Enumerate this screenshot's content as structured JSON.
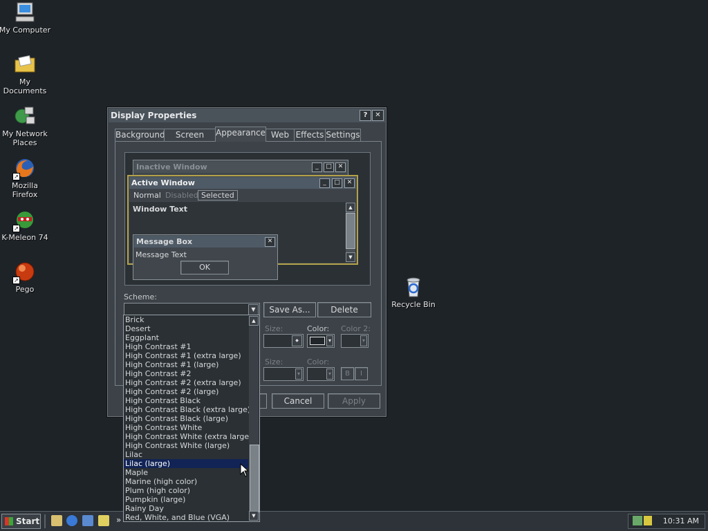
{
  "desktop": {
    "icons": [
      {
        "label": "My Computer",
        "icon": "computer-icon"
      },
      {
        "label": "My Documents",
        "icon": "folder-icon"
      },
      {
        "label": "My Network",
        "label2": "Places",
        "icon": "network-icon"
      },
      {
        "label": "Mozilla Firefox",
        "icon": "firefox-icon"
      },
      {
        "label": "K-Meleon 74",
        "icon": "kmeleon-icon"
      },
      {
        "label": "Pego",
        "icon": "pego-icon"
      },
      {
        "label": "Recycle Bin",
        "icon": "recycle-bin-icon"
      }
    ]
  },
  "dialog": {
    "title": "Display Properties",
    "help_glyph": "?",
    "close_glyph": "✕",
    "tabs": [
      "Background",
      "Screen Saver",
      "Appearance",
      "Web",
      "Effects",
      "Settings"
    ],
    "active_tab": "Appearance",
    "preview": {
      "inactive_title": "Inactive Window",
      "active_title": "Active Window",
      "menu": [
        "Normal",
        "Disabled",
        "Selected"
      ],
      "window_text": "Window Text",
      "msgbox_title": "Message Box",
      "msgbox_text": "Message Text",
      "ok": "OK"
    },
    "scheme_label": "Scheme:",
    "scheme_value": "",
    "save_as": "Save As...",
    "delete": "Delete",
    "size_label": "Size:",
    "color_label": "Color:",
    "color2_label": "Color 2:",
    "size2_label": "Size:",
    "color3_label": "Color:",
    "bold_glyph": "B",
    "italic_glyph": "I",
    "cancel": "Cancel",
    "apply": "Apply"
  },
  "scheme_list": {
    "items": [
      "Brick",
      "Desert",
      "Eggplant",
      "High Contrast #1",
      "High Contrast #1 (extra large)",
      "High Contrast #1 (large)",
      "High Contrast #2",
      "High Contrast #2 (extra large)",
      "High Contrast #2 (large)",
      "High Contrast Black",
      "High Contrast Black (extra large)",
      "High Contrast Black (large)",
      "High Contrast White",
      "High Contrast White (extra large)",
      "High Contrast White (large)",
      "Lilac",
      "Lilac (large)",
      "Maple",
      "Marine (high color)",
      "Plum (high color)",
      "Pumpkin (large)",
      "Rainy Day",
      "Red, White, and Blue (VGA)"
    ],
    "selected": "Lilac (large)"
  },
  "taskbar": {
    "start": "Start",
    "chevron": "»",
    "clock": "10:31 AM"
  },
  "colors": {
    "desktop": "#1e2328",
    "selection": "#122456"
  }
}
